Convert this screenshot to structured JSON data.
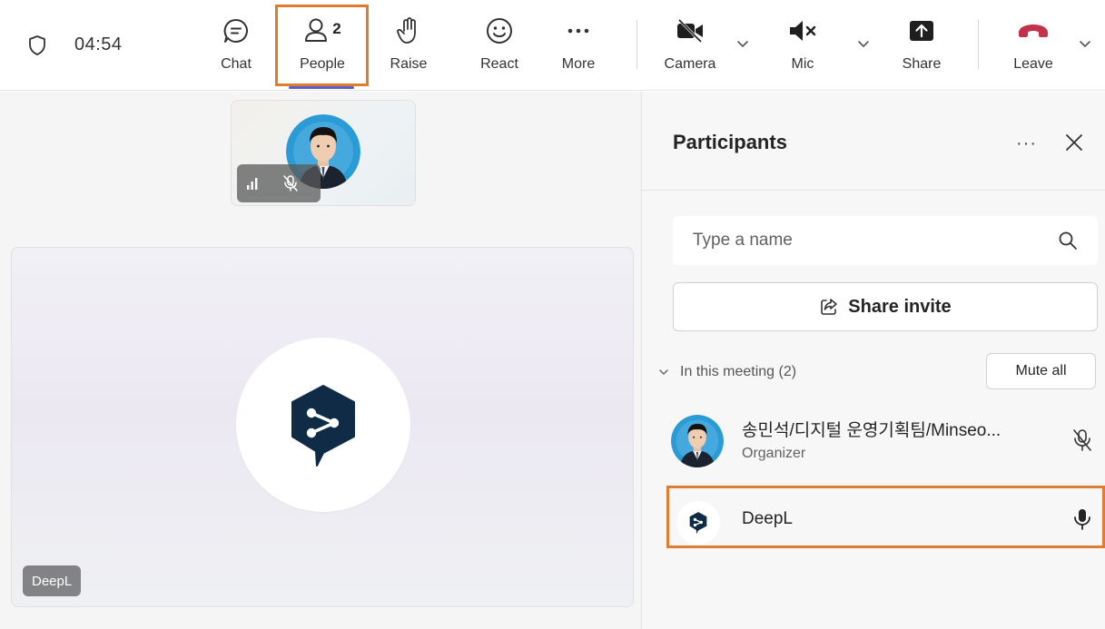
{
  "toolbar": {
    "timer": "04:54",
    "chat_label": "Chat",
    "people_label": "People",
    "people_count": "2",
    "raise_label": "Raise",
    "react_label": "React",
    "more_label": "More",
    "camera_label": "Camera",
    "mic_label": "Mic",
    "share_label": "Share",
    "leave_label": "Leave"
  },
  "stage": {
    "speaker_name": "DeepL"
  },
  "panel": {
    "title": "Participants",
    "more_glyph": "···",
    "search_placeholder": "Type a name",
    "share_invite_label": "Share invite",
    "section_label": "In this meeting (2)",
    "mute_all_label": "Mute all",
    "participants": [
      {
        "name": "송민석/디지털 운영기획팀/Minseo...",
        "role": "Organizer",
        "mic": "muted"
      },
      {
        "name": "DeepL",
        "role": "",
        "mic": "on"
      }
    ]
  },
  "colors": {
    "highlight": "#e07c2e",
    "accent": "#5b5fc7",
    "leave_red": "#c4314b",
    "deepl_navy": "#0f2b46"
  },
  "icons": [
    "shield-icon",
    "chat-icon",
    "people-icon",
    "raise-hand-icon",
    "react-icon",
    "more-icon",
    "camera-off-icon",
    "mic-off-icon",
    "share-icon",
    "leave-icon",
    "chevron-down-icon",
    "signal-icon",
    "mic-muted-icon",
    "deepl-logo-icon",
    "close-icon",
    "search-icon",
    "share-invite-icon",
    "mic-on-icon"
  ]
}
